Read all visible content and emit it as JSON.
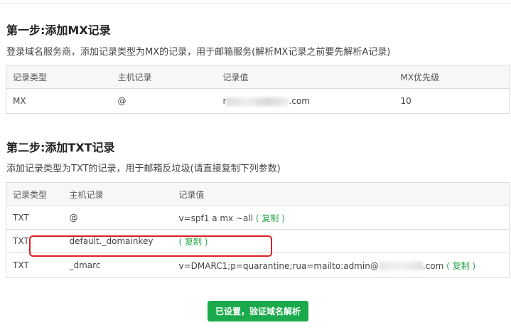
{
  "step1": {
    "title": "第一步:添加MX记录",
    "desc": "登录域名服务商，添加记录类型为MX的记录，用于邮箱服务(解析MX记录之前要先解析A记录)",
    "headers": [
      "记录类型",
      "主机记录",
      "记录值",
      "MX优先级"
    ],
    "row": {
      "type": "MX",
      "host": "@",
      "value_prefix": "r",
      "value_suffix": ".com",
      "priority": "10"
    }
  },
  "step2": {
    "title": "第二步:添加TXT记录",
    "desc": "添加记录类型为TXT的记录，用于邮箱反垃圾(请直接复制下列参数)",
    "headers": [
      "记录类型",
      "主机记录",
      "记录值"
    ],
    "rows": [
      {
        "type": "TXT",
        "host": "@",
        "value": "v=spf1 a mx ~all",
        "copy": "( 复制 )"
      },
      {
        "type": "TXT",
        "host": "default._domainkey",
        "value": "",
        "copy": "( 复制 )"
      },
      {
        "type": "TXT",
        "host": "_dmarc",
        "value": "v=DMARC1;p=quarantine;rua=mailto:admin@",
        "value_suffix": ".com",
        "copy": "( 复制 )"
      }
    ]
  },
  "button": {
    "label": "已设置，验证域名解析"
  },
  "colors": {
    "accent": "#1aaa4b",
    "copy_link": "#2aa84a",
    "highlight": "#e02020"
  }
}
